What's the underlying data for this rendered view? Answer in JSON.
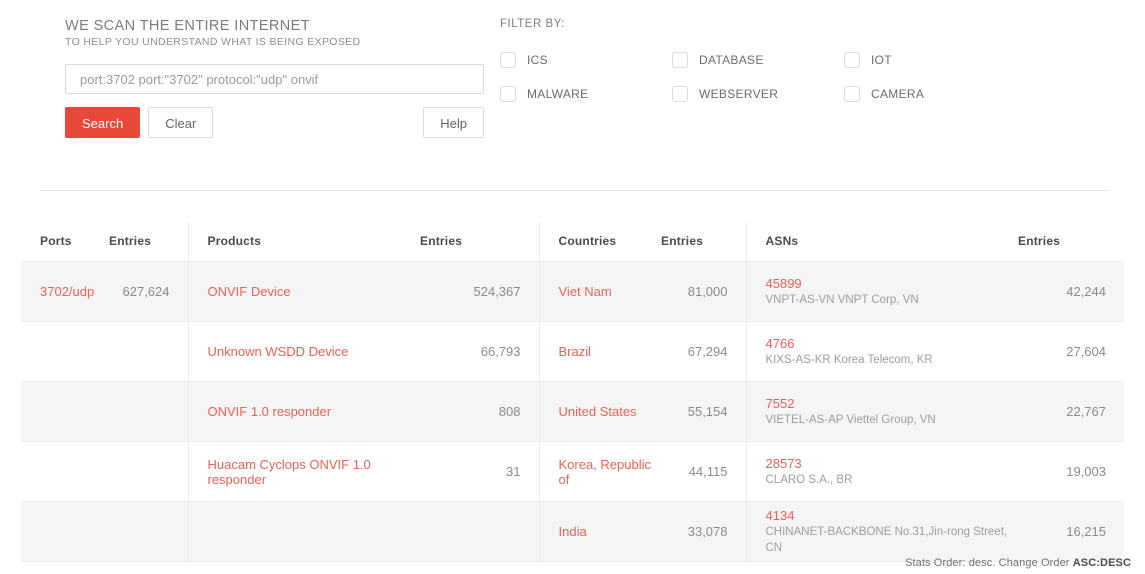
{
  "search": {
    "heading": "WE SCAN THE ENTIRE INTERNET",
    "subheading": "TO HELP YOU UNDERSTAND WHAT IS BEING EXPOSED",
    "query_value": "port:3702 port:\"3702\" protocol:\"udp\" onvif",
    "placeholder": "port:3702 port:\"3702\" protocol:\"udp\" onvif",
    "search_label": "Search",
    "clear_label": "Clear",
    "help_label": "Help"
  },
  "filters": {
    "title": "FILTER BY:",
    "items": [
      {
        "label": "ICS",
        "checked": false
      },
      {
        "label": "DATABASE",
        "checked": false
      },
      {
        "label": "IOT",
        "checked": false
      },
      {
        "label": "MALWARE",
        "checked": false
      },
      {
        "label": "WEBSERVER",
        "checked": false
      },
      {
        "label": "CAMERA",
        "checked": false
      }
    ]
  },
  "table": {
    "headers": {
      "ports": "Ports",
      "ports_entries": "Entries",
      "products": "Products",
      "products_entries": "Entries",
      "countries": "Countries",
      "countries_entries": "Entries",
      "asns": "ASNs",
      "asns_entries": "Entries"
    },
    "ports": [
      {
        "label": "3702/udp",
        "entries": "627,624"
      },
      {
        "label": "",
        "entries": ""
      },
      {
        "label": "",
        "entries": ""
      },
      {
        "label": "",
        "entries": ""
      },
      {
        "label": "",
        "entries": ""
      }
    ],
    "products": [
      {
        "label": "ONVIF Device",
        "entries": "524,367"
      },
      {
        "label": "Unknown WSDD Device",
        "entries": "66,793"
      },
      {
        "label": "ONVIF 1.0 responder",
        "entries": "808"
      },
      {
        "label": "Huacam Cyclops ONVIF 1.0 responder",
        "entries": "31"
      },
      {
        "label": "",
        "entries": ""
      }
    ],
    "countries": [
      {
        "label": "Viet Nam",
        "entries": "81,000"
      },
      {
        "label": "Brazil",
        "entries": "67,294"
      },
      {
        "label": "United States",
        "entries": "55,154"
      },
      {
        "label": "Korea, Republic of",
        "entries": "44,115"
      },
      {
        "label": "India",
        "entries": "33,078"
      }
    ],
    "asns": [
      {
        "number": "45899",
        "description": "VNPT-AS-VN VNPT Corp, VN",
        "entries": "42,244"
      },
      {
        "number": "4766",
        "description": "KIXS-AS-KR Korea Telecom, KR",
        "entries": "27,604"
      },
      {
        "number": "7552",
        "description": "VIETEL-AS-AP Viettel Group, VN",
        "entries": "22,767"
      },
      {
        "number": "28573",
        "description": "CLARO S.A., BR",
        "entries": "19,003"
      },
      {
        "number": "4134",
        "description": "CHINANET-BACKBONE No.31,Jin-rong Street, CN",
        "entries": "16,215"
      }
    ]
  },
  "footer": {
    "text": "Stats Order: desc. Change Order",
    "asc_label": "ASC",
    "separator": ":",
    "desc_label": "DESC"
  },
  "colors": {
    "accent": "#e8483a",
    "link": "#ec6155",
    "row_stripe": "#f5f5f5",
    "border": "#ededed"
  }
}
